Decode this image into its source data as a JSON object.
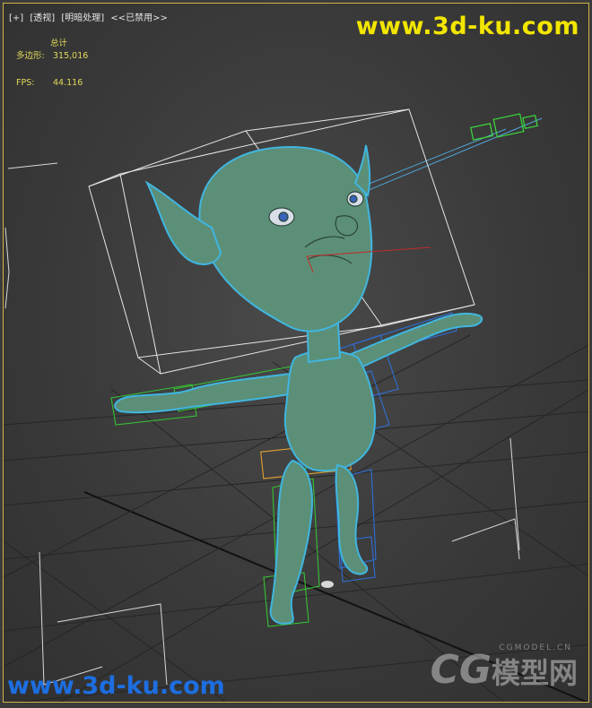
{
  "viewport": {
    "labels": [
      "[+]",
      "[透视]",
      "[明暗处理]",
      "<<已禁用>>"
    ],
    "stats": {
      "total_label": "总计",
      "polygons_label": "多边形:",
      "polygons_value": "315,016",
      "fps_label": "FPS:",
      "fps_value": "44.116"
    }
  },
  "watermarks": {
    "top": "www.3d-ku.com",
    "bottom": "www.3d-ku.com",
    "logo_main": "CG",
    "logo_cn": "模型网",
    "logo_small": "CGMODEL.CN"
  },
  "colors": {
    "stats_text": "#e3d95a",
    "viewport_border": "#d2b24a",
    "character_fill": "#5c8f78",
    "selection_outline": "#3fb6e0",
    "bone_green": "#34c234",
    "bone_blue": "#2f6fd6",
    "watermark_yellow": "#f2e600",
    "watermark_blue": "#1d6ee0"
  }
}
